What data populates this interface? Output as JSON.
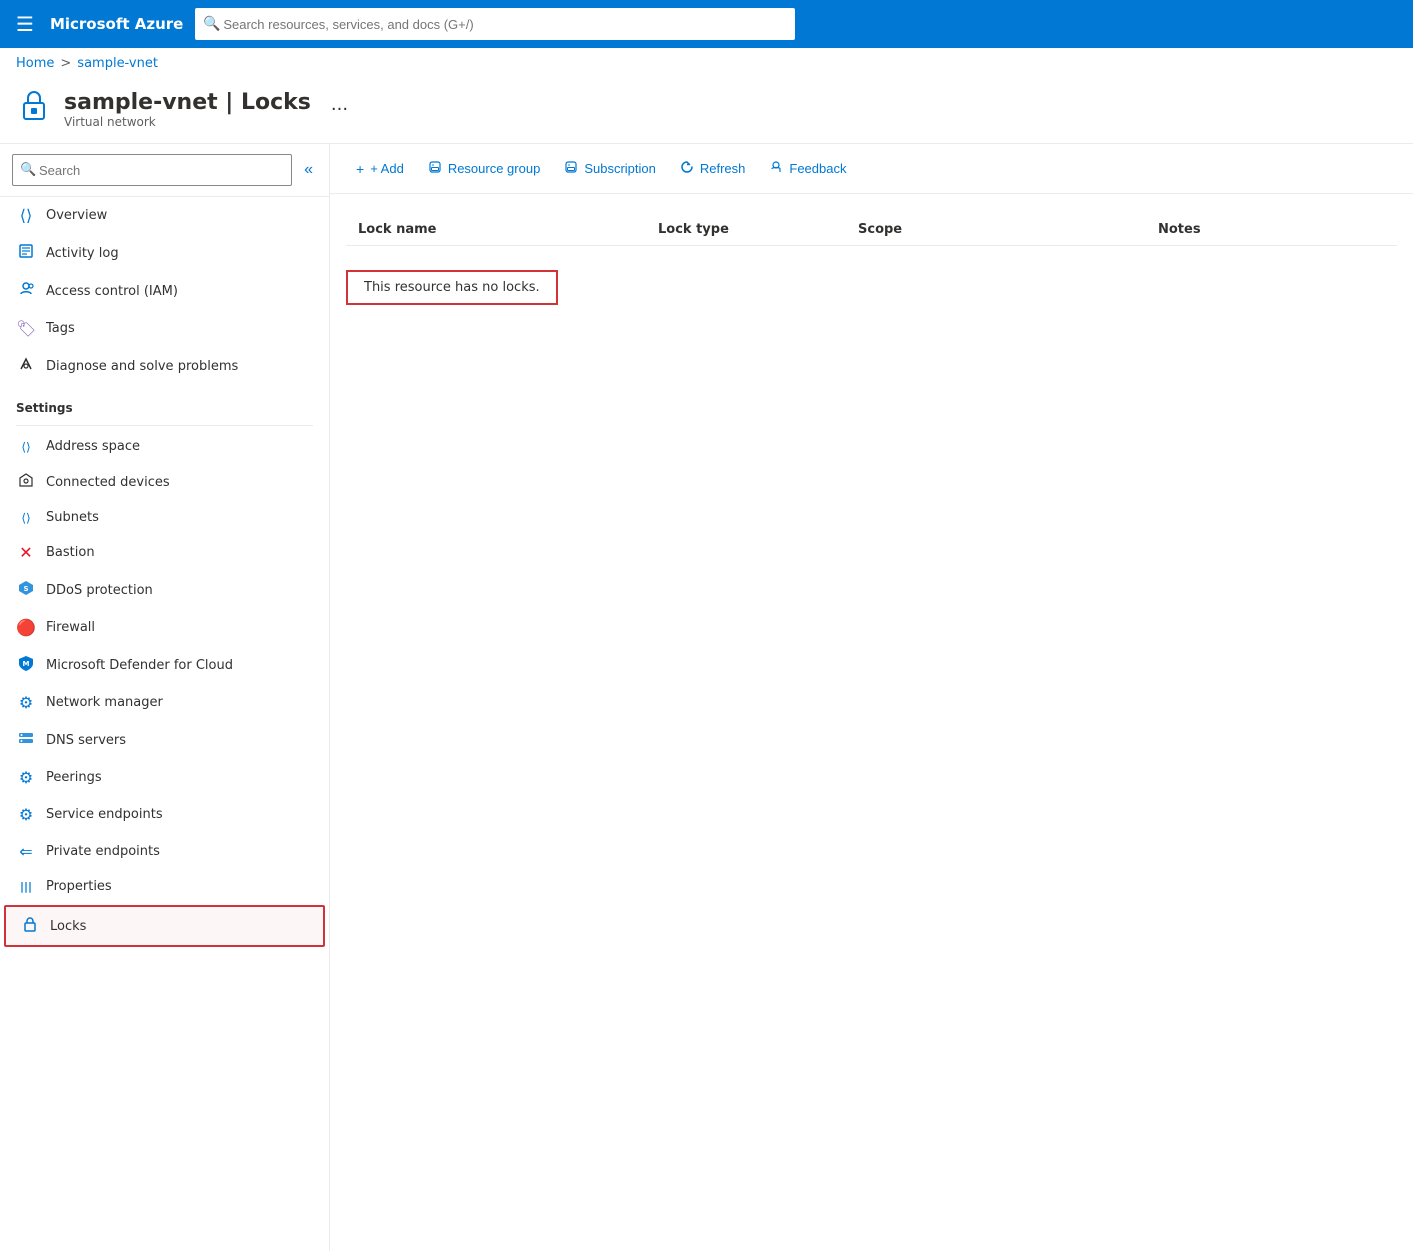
{
  "topbar": {
    "hamburger_icon": "☰",
    "logo": "Microsoft Azure",
    "search_placeholder": "Search resources, services, and docs (G+/)"
  },
  "breadcrumb": {
    "home": "Home",
    "separator": ">",
    "resource": "sample-vnet"
  },
  "resource_header": {
    "title": "sample-vnet | Locks",
    "subtitle": "Virtual network",
    "more_icon": "···"
  },
  "sidebar": {
    "search_placeholder": "Search",
    "collapse_icon": "«",
    "nav_items": [
      {
        "id": "overview",
        "label": "Overview",
        "icon": "⟨⟩"
      },
      {
        "id": "activity-log",
        "label": "Activity log",
        "icon": "📋"
      },
      {
        "id": "access-control",
        "label": "Access control (IAM)",
        "icon": "👤"
      },
      {
        "id": "tags",
        "label": "Tags",
        "icon": "🏷"
      },
      {
        "id": "diagnose",
        "label": "Diagnose and solve problems",
        "icon": "🔧"
      }
    ],
    "settings_label": "Settings",
    "settings_items": [
      {
        "id": "address-space",
        "label": "Address space",
        "icon": "⟨⟩"
      },
      {
        "id": "connected-devices",
        "label": "Connected devices",
        "icon": "🔌"
      },
      {
        "id": "subnets",
        "label": "Subnets",
        "icon": "⟨⟩"
      },
      {
        "id": "bastion",
        "label": "Bastion",
        "icon": "✕"
      },
      {
        "id": "ddos",
        "label": "DDoS protection",
        "icon": "🛡"
      },
      {
        "id": "firewall",
        "label": "Firewall",
        "icon": "🔴"
      },
      {
        "id": "defender",
        "label": "Microsoft Defender for Cloud",
        "icon": "🛡"
      },
      {
        "id": "network-manager",
        "label": "Network manager",
        "icon": "⚙"
      },
      {
        "id": "dns-servers",
        "label": "DNS servers",
        "icon": "🖥"
      },
      {
        "id": "peerings",
        "label": "Peerings",
        "icon": "⚙"
      },
      {
        "id": "service-endpoints",
        "label": "Service endpoints",
        "icon": "⚙"
      },
      {
        "id": "private-endpoints",
        "label": "Private endpoints",
        "icon": "⟵"
      },
      {
        "id": "properties",
        "label": "Properties",
        "icon": "|||"
      },
      {
        "id": "locks",
        "label": "Locks",
        "icon": "🔒",
        "active": true
      }
    ]
  },
  "toolbar": {
    "add_label": "+ Add",
    "resource_group_label": "Resource group",
    "subscription_label": "Subscription",
    "refresh_label": "Refresh",
    "feedback_label": "Feedback"
  },
  "table": {
    "columns": [
      "Lock name",
      "Lock type",
      "Scope",
      "Notes"
    ],
    "empty_message": "This resource has no locks."
  }
}
